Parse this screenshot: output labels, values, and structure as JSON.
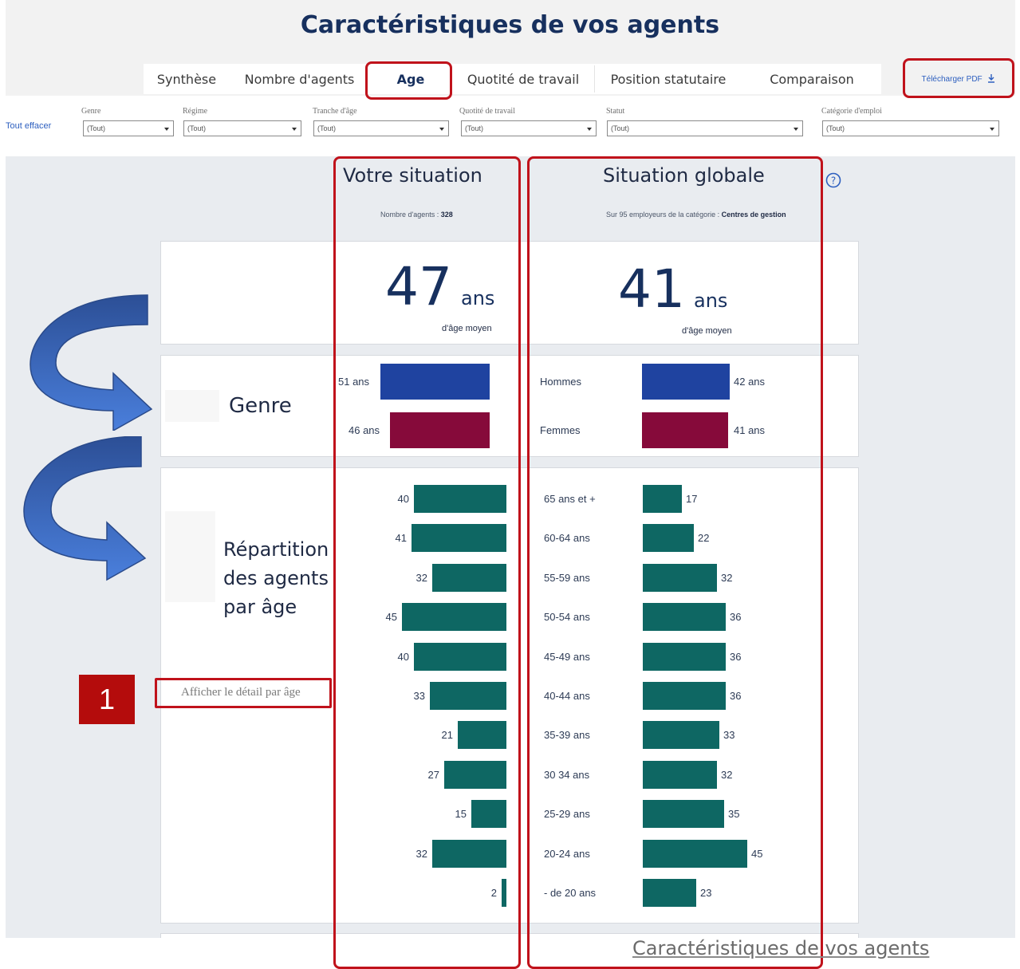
{
  "page": {
    "title": "Caractéristiques de vos agents",
    "footer": "Caractéristiques de vos agents"
  },
  "tabs": [
    {
      "label": "Synthèse",
      "active": false
    },
    {
      "label": "Nombre d'agents",
      "active": false
    },
    {
      "label": "Age",
      "active": true
    },
    {
      "label": "Quotité de travail",
      "active": false
    },
    {
      "label": "Position statutaire",
      "active": false
    },
    {
      "label": "Comparaison",
      "active": false
    }
  ],
  "toolbar": {
    "download_label": "Télécharger PDF",
    "download_icon": "download-icon",
    "clear_all": "Tout effacer"
  },
  "filters": [
    {
      "label": "Genre",
      "value": "(Tout)"
    },
    {
      "label": "Régime",
      "value": "(Tout)"
    },
    {
      "label": "Tranche d'âge",
      "value": "(Tout)"
    },
    {
      "label": "Quotité de travail",
      "value": "(Tout)"
    },
    {
      "label": "Statut",
      "value": "(Tout)"
    },
    {
      "label": "Catégorie d'emploi",
      "value": "(Tout)"
    }
  ],
  "columns": {
    "yours": {
      "title": "Votre situation",
      "sub_prefix": "Nombre d'agents : ",
      "sub_value": "328"
    },
    "global": {
      "title": "Situation globale",
      "sub_prefix": "Sur 95 employeurs de la catégorie : ",
      "sub_value": "Centres de gestion"
    }
  },
  "average_age": {
    "yours": {
      "value": "47",
      "unit": "ans",
      "caption": "d'âge moyen"
    },
    "global": {
      "value": "41",
      "unit": "ans",
      "caption": "d'âge moyen"
    }
  },
  "genre": {
    "title": "Genre",
    "rows": [
      {
        "label": "Hommes",
        "yours": "51 ans",
        "global": "42 ans",
        "yours_value": 51,
        "global_value": 42,
        "color": "#1f43a0"
      },
      {
        "label": "Femmes",
        "yours": "46 ans",
        "global": "41 ans",
        "yours_value": 46,
        "global_value": 41,
        "color": "#860a3a"
      }
    ]
  },
  "age_distribution": {
    "title_lines": [
      "Répartition",
      "des agents",
      "par âge"
    ],
    "detail_link": "Afficher le détail par âge",
    "bar_color": "#0e6763",
    "categories": [
      "65 ans et +",
      "60-64 ans",
      "55-59 ans",
      "50-54 ans",
      "45-49 ans",
      "40-44 ans",
      "35-39 ans",
      "30 34 ans",
      "25-29 ans",
      "20-24 ans",
      "- de 20 ans"
    ],
    "yours": [
      "40",
      "41",
      "32",
      "45",
      "40",
      "33",
      "21",
      "27",
      "15",
      "32",
      "2"
    ],
    "global": [
      "17",
      "22",
      "32",
      "36",
      "36",
      "36",
      "33",
      "32",
      "35",
      "45",
      "23"
    ]
  },
  "annotation": {
    "badge": "1"
  },
  "colors": {
    "accent_red": "#c0121b",
    "arrow_blue": "#3d6fd0",
    "title_navy": "#17305e"
  }
}
